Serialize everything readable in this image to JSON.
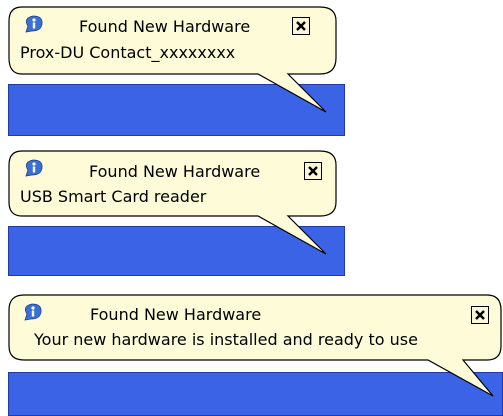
{
  "colors": {
    "balloon_fill": "#fdfbd8",
    "balloon_border": "#000000",
    "taskbar": "#3b63e6",
    "info_icon": "#3a6fd6"
  },
  "notifications": [
    {
      "title": "Found New Hardware",
      "message": "Prox-DU Contact_xxxxxxxx",
      "icon": "info-icon",
      "close": "close-icon"
    },
    {
      "title": "Found New Hardware",
      "message": "USB Smart Card reader",
      "icon": "info-icon",
      "close": "close-icon"
    },
    {
      "title": "Found New Hardware",
      "message": "Your new hardware is installed and ready to use",
      "icon": "info-icon",
      "close": "close-icon"
    }
  ]
}
